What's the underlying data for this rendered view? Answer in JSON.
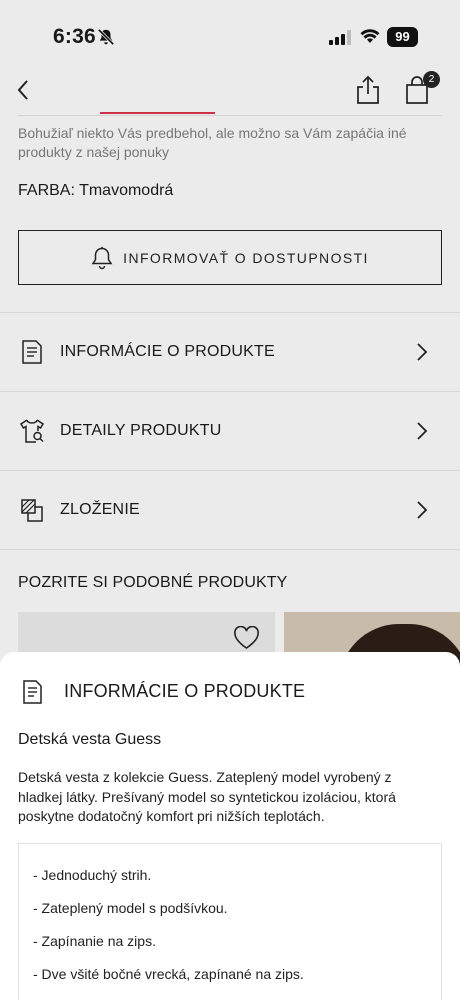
{
  "status_bar": {
    "time": "6:36",
    "battery": "99"
  },
  "nav": {
    "cart_count": "2"
  },
  "product": {
    "unavailable_message": "Bohužiaľ niekto Vás predbehol, ale možno sa Vám zapáčia iné produkty z našej ponuky",
    "color_label": "FARBA:",
    "color_value": "Tmavomodrá",
    "notify_button": "INFORMOVAŤ O DOSTUPNOSTI"
  },
  "accordion": [
    {
      "label": "INFORMÁCIE O PRODUKTE",
      "icon": "document-icon"
    },
    {
      "label": "DETAILY PRODUKTU",
      "icon": "tshirt-search-icon"
    },
    {
      "label": "ZLOŽENIE",
      "icon": "fabric-layers-icon"
    }
  ],
  "similar": {
    "title": "POZRITE SI PODOBNÉ PRODUKTY"
  },
  "sheet": {
    "title": "INFORMÁCIE O PRODUKTE",
    "product_name": "Detská vesta Guess",
    "description": "Detská vesta z kolekcie Guess. Zateplený model vyrobený z hladkej látky. Prešívaný model so syntetickou izoláciou, ktorá poskytne dodatočný komfort pri nižších teplotách.",
    "features": [
      "- Jednoduchý strih.",
      "- Zateplený model s podšívkou.",
      "- Zapínanie na zips.",
      "- Dve všité bočné vrecká, zapínané na zips."
    ]
  },
  "colors": {
    "background": "#ebebeb",
    "sheet": "#ffffff",
    "accent_red": "#c8102e",
    "text": "#1a1a1a"
  }
}
